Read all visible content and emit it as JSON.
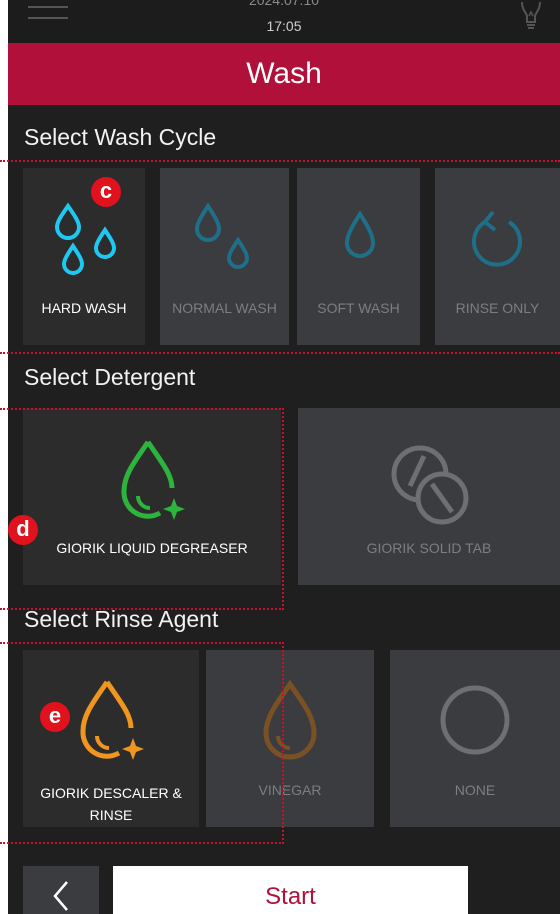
{
  "status": {
    "date": "2024.07.10",
    "time": "17:05"
  },
  "header": {
    "title": "Wash"
  },
  "wash_cycle": {
    "title": "Select Wash Cycle",
    "options": [
      {
        "label": "HARD WASH",
        "selected": true,
        "icon": "three-drops-icon"
      },
      {
        "label": "NORMAL WASH",
        "selected": false,
        "icon": "two-drops-icon"
      },
      {
        "label": "SOFT WASH",
        "selected": false,
        "icon": "drop-icon"
      },
      {
        "label": "RINSE ONLY",
        "selected": false,
        "icon": "rinse-arrow-icon"
      }
    ],
    "badge": "c"
  },
  "detergent": {
    "title": "Select Detergent",
    "options": [
      {
        "label": "GIORIK LIQUID DEGREASER",
        "selected": true,
        "icon": "liquid-drop-sparkle-icon"
      },
      {
        "label": "GIORIK SOLID TAB",
        "selected": false,
        "icon": "solid-tab-icon"
      }
    ],
    "badge": "d"
  },
  "rinse_agent": {
    "title": "Select Rinse Agent",
    "options": [
      {
        "label": "GIORIK DESCALER & RINSE",
        "selected": true,
        "icon": "rinse-drop-sparkle-icon"
      },
      {
        "label": "VINEGAR",
        "selected": false,
        "icon": "vinegar-drop-icon"
      },
      {
        "label": "NONE",
        "selected": false,
        "icon": "none-circle-icon"
      }
    ],
    "badge": "e"
  },
  "footer": {
    "start_label": "Start"
  },
  "colors": {
    "accent": "#b0103a",
    "cyan": "#1ec8f0",
    "green": "#2db43c",
    "orange": "#f0961e",
    "annotation": "#e0121d"
  }
}
